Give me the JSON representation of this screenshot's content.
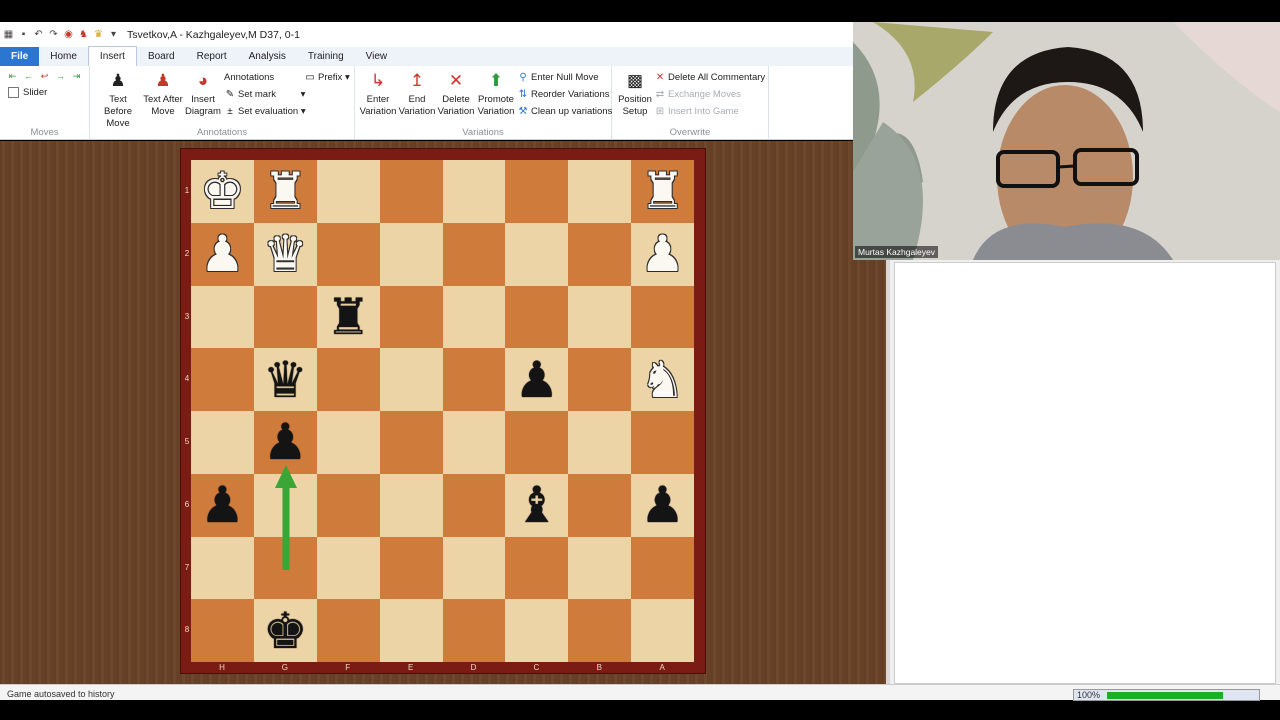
{
  "window": {
    "title": "Tsvetkov,A - Kazhgaleyev,M  D37, 0-1"
  },
  "tabs": [
    {
      "label": "File"
    },
    {
      "label": "Home"
    },
    {
      "label": "Insert"
    },
    {
      "label": "Board"
    },
    {
      "label": "Report"
    },
    {
      "label": "Analysis"
    },
    {
      "label": "Training"
    },
    {
      "label": "View"
    }
  ],
  "ribbon": {
    "moves": {
      "label": "Moves",
      "slider_label": "Slider"
    },
    "annotations": {
      "label": "Annotations",
      "text_before_move": [
        "Text Before",
        "Move"
      ],
      "text_after_move": [
        "Text After",
        "Move"
      ],
      "insert_diagram": [
        "Insert",
        "Diagram"
      ],
      "annotations_btn": "Annotations",
      "set_mark": "Set mark",
      "set_evaluation": "Set evaluation",
      "prefix": "Prefix"
    },
    "variations": {
      "label": "Variations",
      "enter_variation": [
        "Enter",
        "Variation"
      ],
      "end_variation": [
        "End",
        "Variation"
      ],
      "delete_variation": [
        "Delete",
        "Variation"
      ],
      "promote_variation": [
        "Promote",
        "Variation"
      ],
      "enter_null_move": "Enter Null Move",
      "reorder_variations": "Reorder Variations",
      "clean_up_variations": "Clean up variations"
    },
    "overwrite": {
      "label": "Overwrite",
      "position_setup": [
        "Position",
        "Setup"
      ],
      "delete_all_commentary": "Delete All Commentary",
      "exchange_moves": "Exchange Moves",
      "insert_into_game": "Insert Into Game"
    }
  },
  "board": {
    "ranks": [
      "1",
      "2",
      "3",
      "4",
      "5",
      "6",
      "7",
      "8"
    ],
    "files": [
      "H",
      "G",
      "F",
      "E",
      "D",
      "C",
      "B",
      "A"
    ],
    "light_color": "#ecd4a6",
    "dark_color": "#cf7b3c",
    "pieces": [
      {
        "row": 0,
        "col": 0,
        "glyph": "♚",
        "color": "white",
        "name": "white-king"
      },
      {
        "row": 0,
        "col": 1,
        "glyph": "♜",
        "color": "white",
        "name": "white-rook"
      },
      {
        "row": 0,
        "col": 7,
        "glyph": "♜",
        "color": "white",
        "name": "white-rook"
      },
      {
        "row": 1,
        "col": 0,
        "glyph": "♟",
        "color": "white",
        "name": "white-pawn"
      },
      {
        "row": 1,
        "col": 1,
        "glyph": "♛",
        "color": "white",
        "name": "white-queen"
      },
      {
        "row": 1,
        "col": 7,
        "glyph": "♟",
        "color": "white",
        "name": "white-pawn"
      },
      {
        "row": 2,
        "col": 2,
        "glyph": "♜",
        "color": "black",
        "name": "black-rook"
      },
      {
        "row": 3,
        "col": 1,
        "glyph": "♛",
        "color": "black",
        "name": "black-queen"
      },
      {
        "row": 3,
        "col": 5,
        "glyph": "♟",
        "color": "black",
        "name": "black-pawn"
      },
      {
        "row": 3,
        "col": 7,
        "glyph": "♞",
        "color": "white",
        "name": "white-knight"
      },
      {
        "row": 4,
        "col": 1,
        "glyph": "♟",
        "color": "black",
        "name": "black-pawn"
      },
      {
        "row": 5,
        "col": 0,
        "glyph": "♟",
        "color": "black",
        "name": "black-pawn"
      },
      {
        "row": 5,
        "col": 5,
        "glyph": "♝",
        "color": "black",
        "name": "black-bishop"
      },
      {
        "row": 5,
        "col": 7,
        "glyph": "♟",
        "color": "black",
        "name": "black-pawn"
      },
      {
        "row": 7,
        "col": 1,
        "glyph": "♚",
        "color": "black",
        "name": "black-king"
      }
    ],
    "arrow": {
      "from": "G7",
      "to": "G5",
      "color": "#3aa635"
    }
  },
  "webcam": {
    "participant_name": "Murtas Kazhgaleyev"
  },
  "status": {
    "message": "Game autosaved to history",
    "zoom_label": "100%",
    "zoom_fraction": 0.77,
    "zoom_color": "#19b025"
  }
}
